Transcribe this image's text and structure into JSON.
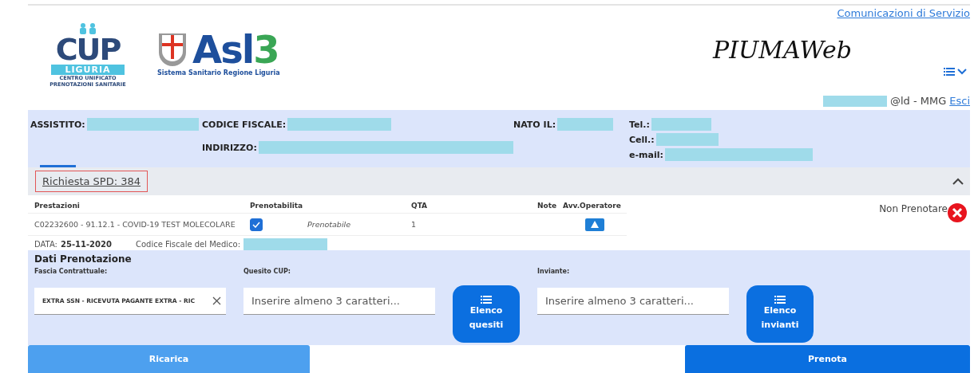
{
  "header": {
    "service_link": "Comunicazioni di Servizio",
    "cup_logo": {
      "name": "CUP",
      "region": "LIGURIA",
      "line_1": "CENTRO UNIFICATO",
      "line_2": "PRENOTAZIONI SANITARIE"
    },
    "asl_logo": {
      "name": "Asl",
      "number": "3",
      "tagline": "Sistema Sanitario Regione Liguria"
    },
    "app_name": "PIUMAWeb",
    "user": {
      "role": "@ld - MMG",
      "logout": "Esci"
    }
  },
  "patient": {
    "fields": [
      {
        "label": "ASSISTITO:"
      },
      {
        "label": "CODICE FISCALE:"
      },
      {
        "label": "INDIRIZZO:"
      },
      {
        "label": "NATO IL:"
      },
      {
        "label": "Tel.:"
      },
      {
        "label": "Cell.:"
      },
      {
        "label": "e-mail:"
      }
    ]
  },
  "request": {
    "title": "Richiesta SPD: 384",
    "expanded": true,
    "columns": [
      "Prestazioni",
      "Prenotabilita",
      "QTA",
      "Note",
      "Avv.Operatore"
    ],
    "rows": [
      {
        "prestazione": "C02232600 - 91.12.1 - COVID-19 TEST MOLECOLARE",
        "checked": true,
        "status": "Prenotabile",
        "qta": "1"
      }
    ],
    "date_label": "DATA:",
    "date": "25-11-2020",
    "doctor_label": "Codice Fiscale del Medico:",
    "exclude": "Non Prenotare"
  },
  "booking": {
    "title": "Dati Prenotazione",
    "fields": [
      {
        "kind": "select",
        "label": "Fascia Contrattuale:",
        "value": "EXTRA SSN - RICEVUTA PAGANTE EXTRA - RIC"
      },
      {
        "kind": "search",
        "label": "Quesito CUP:",
        "placeholder": "Inserire almeno 3 caratteri...",
        "button": [
          "Elenco",
          "quesiti"
        ]
      },
      {
        "kind": "search",
        "label": "Inviante:",
        "placeholder": "Inserire almeno 3 caratteri...",
        "button": [
          "Elenco",
          "invianti"
        ]
      }
    ]
  },
  "actions": {
    "reload": "Ricarica",
    "submit": "Prenota"
  }
}
